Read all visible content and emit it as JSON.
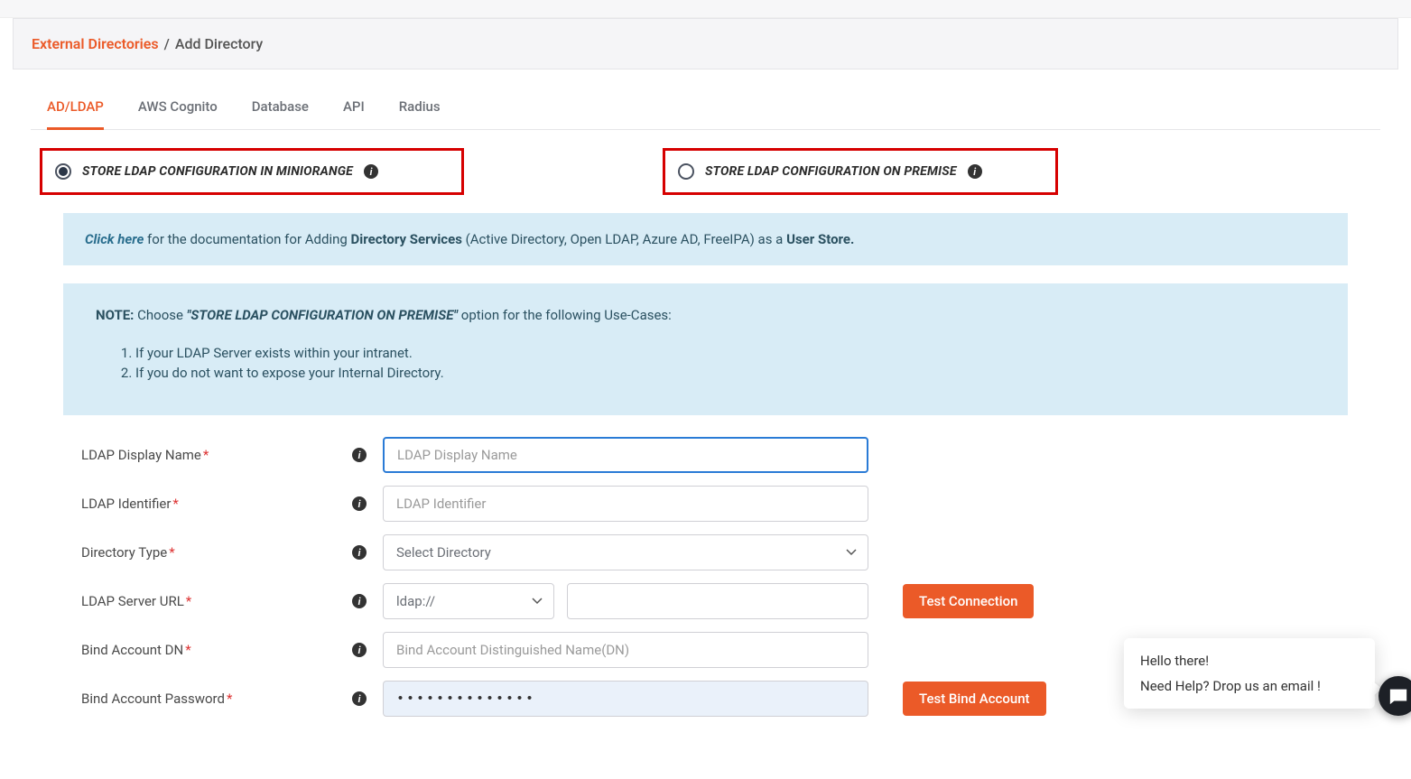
{
  "breadcrumb": {
    "parent": "External Directories",
    "sep": "/",
    "current": "Add Directory"
  },
  "tabs": [
    {
      "label": "AD/LDAP",
      "active": true
    },
    {
      "label": "AWS Cognito",
      "active": false
    },
    {
      "label": "Database",
      "active": false
    },
    {
      "label": "API",
      "active": false
    },
    {
      "label": "Radius",
      "active": false
    }
  ],
  "storage_options": {
    "miniorange": "STORE LDAP CONFIGURATION IN MINIORANGE",
    "premise": "STORE LDAP CONFIGURATION ON PREMISE"
  },
  "doc_banner": {
    "link": "Click here",
    "pre": " for the documentation for Adding ",
    "bold1": "Directory Services",
    "mid": " (Active Directory, Open LDAP, Azure AD, FreeIPA) as a ",
    "bold2": "User Store."
  },
  "note_banner": {
    "label": "NOTE:",
    "pre": "  Choose ",
    "emph": "\"STORE LDAP CONFIGURATION ON PREMISE\"",
    "post": " option for the following Use-Cases:",
    "items": [
      "If your LDAP Server exists within your intranet.",
      "If you do not want to expose your Internal Directory."
    ]
  },
  "form": {
    "ldap_display_name": {
      "label": "LDAP Display Name",
      "placeholder": "LDAP Display Name",
      "value": ""
    },
    "ldap_identifier": {
      "label": "LDAP Identifier",
      "placeholder": "LDAP Identifier",
      "value": ""
    },
    "directory_type": {
      "label": "Directory Type",
      "placeholder": "Select Directory",
      "value": ""
    },
    "ldap_server_url": {
      "label": "LDAP Server URL",
      "protocol": "ldap://",
      "host": ""
    },
    "bind_dn": {
      "label": "Bind Account DN",
      "placeholder": "Bind Account Distinguished Name(DN)",
      "value": ""
    },
    "bind_password": {
      "label": "Bind Account Password",
      "value": "••••••••••••••"
    }
  },
  "buttons": {
    "test_connection": "Test Connection",
    "test_bind": "Test Bind Account"
  },
  "chat": {
    "line1": "Hello there!",
    "line2": "Need Help? Drop us an email !"
  },
  "glyphs": {
    "info": "i"
  }
}
